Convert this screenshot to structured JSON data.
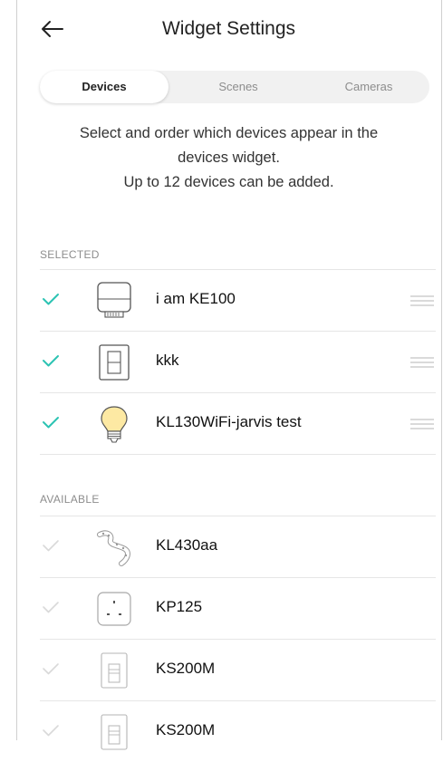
{
  "header": {
    "title": "Widget Settings"
  },
  "tabs": [
    {
      "label": "Devices",
      "active": true
    },
    {
      "label": "Scenes",
      "active": false
    },
    {
      "label": "Cameras",
      "active": false
    }
  ],
  "description": {
    "line1": "Select and order which devices appear in the",
    "line2": "devices widget.",
    "line3": "Up to 12 devices can be added."
  },
  "selected": {
    "label": "SELECTED",
    "items": [
      {
        "name": "i am KE100",
        "icon": "thermostat-valve-icon",
        "checked": true
      },
      {
        "name": "kkk",
        "icon": "light-switch-icon",
        "checked": true
      },
      {
        "name": "KL130WiFi-jarvis test",
        "icon": "light-bulb-icon",
        "checked": true
      }
    ]
  },
  "available": {
    "label": "AVAILABLE",
    "items": [
      {
        "name": "KL430aa",
        "icon": "light-strip-icon",
        "checked": false
      },
      {
        "name": "KP125",
        "icon": "smart-plug-icon",
        "checked": false
      },
      {
        "name": "KS200M",
        "icon": "wall-switch-icon",
        "checked": false
      },
      {
        "name": "KS200M",
        "icon": "wall-switch-icon",
        "checked": false
      }
    ]
  },
  "colors": {
    "accent": "#2cc3b3",
    "check_inactive": "#d9d9d9",
    "bulb": "#fde9a3"
  }
}
